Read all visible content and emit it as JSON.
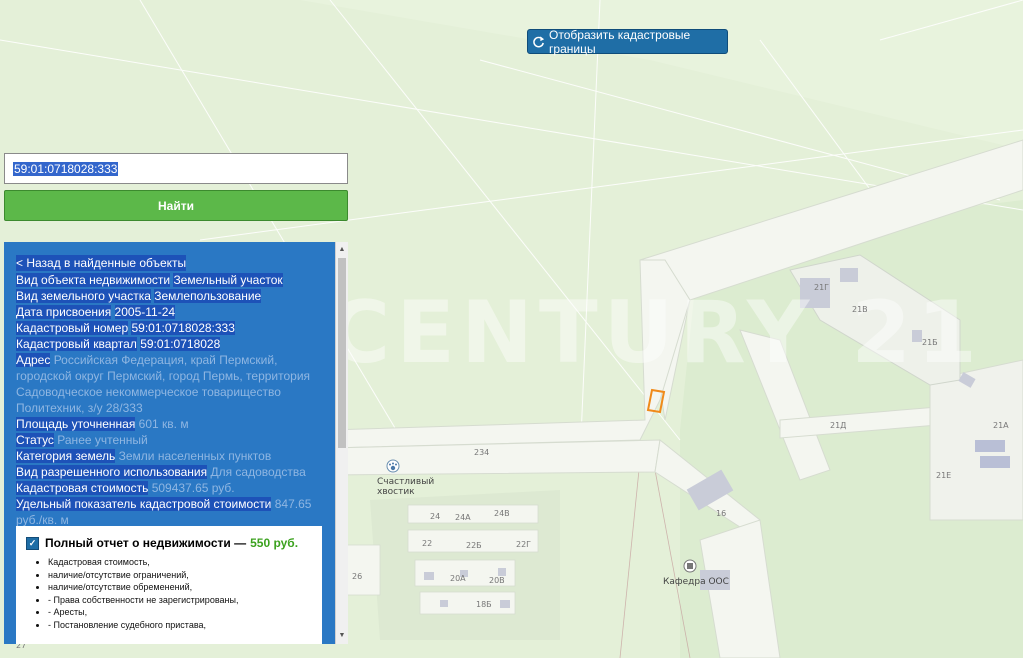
{
  "map": {
    "cadastre_button_label": "Отобразить кадастровые границы",
    "watermark": "CENTURY 21",
    "building_labels": [
      "21Г",
      "21В",
      "21Б",
      "21Д",
      "21А",
      "21Е",
      "16",
      "234",
      "24",
      "24А",
      "24В",
      "22",
      "22Б",
      "22Г",
      "20А",
      "20В",
      "18Б",
      "26",
      "27"
    ],
    "pois": [
      {
        "name": "Счастливый хвостик",
        "icon": "paw-icon"
      },
      {
        "name": "Кафедра ООС",
        "icon": "building-icon"
      }
    ]
  },
  "search": {
    "value": "59:01:0718028:333",
    "button_label": "Найти"
  },
  "info": {
    "back_link": "< Назад в найденные объекты",
    "fields": [
      {
        "label": "Вид объекта недвижимости",
        "value": "Земельный участок",
        "bright": true
      },
      {
        "label": "Вид земельного участка",
        "value": "Землепользование",
        "bright": true
      },
      {
        "label": "Дата присвоения",
        "value": "2005-11-24",
        "bright": true
      },
      {
        "label": "Кадастровый номер",
        "value": "59:01:0718028:333",
        "bright": true
      },
      {
        "label": "Кадастровый квартал",
        "value": "59:01:0718028",
        "bright": true
      },
      {
        "label": "Адрес",
        "value": "Российская Федерация, край Пермский, городской округ Пермский, город Пермь, территория Садоводческое некоммерческое товарищество Политехник, з/у 28/333",
        "bright": false
      },
      {
        "label": "Площадь уточненная",
        "value": "601 кв. м",
        "bright": false
      },
      {
        "label": "Статус",
        "value": "Ранее учтенный",
        "bright": false
      },
      {
        "label": "Категория земель",
        "value": "Земли населенных пунктов",
        "bright": false
      },
      {
        "label": "Вид разрешенного использования",
        "value": "Для садоводства",
        "bright": false
      },
      {
        "label": "Кадастровая стоимость",
        "value": "509437.65 руб.",
        "bright": false
      },
      {
        "label": "Удельный показатель кадастровой стоимости",
        "value": "847.65 руб./кв. м",
        "bright": false
      }
    ],
    "collapse_symbol": "▲"
  },
  "report": {
    "checked": true,
    "title": "Полный отчет о недвижимости —",
    "price": "550 руб.",
    "items": [
      "Кадастровая стоимость,",
      "наличие/отсутствие ограничений,",
      "наличие/отсутствие обременений,",
      "- Права собственности не зарегистрированы,",
      "- Аресты,",
      "- Постановление судебного пристава,"
    ]
  }
}
